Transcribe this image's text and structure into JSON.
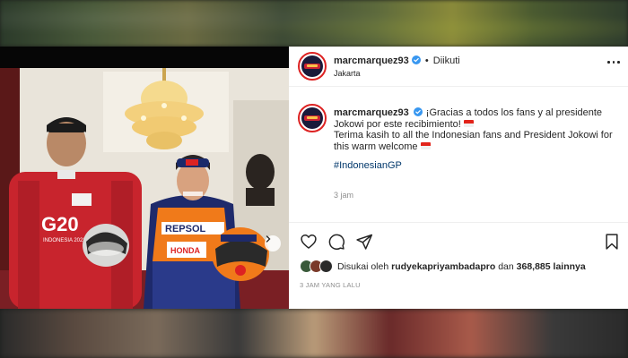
{
  "post": {
    "username": "marcmarquez93",
    "follow_status": "Diikuti",
    "location": "Jakarta",
    "caption": {
      "username": "marcmarquez93",
      "line1": "¡Gracias a todos los fans y al presidente Jokowi por este recibimiento!",
      "line2": "Terima kasih to all the Indonesian fans and President Jokowi for this warm welcome",
      "hashtag": "#IndonesianGP",
      "time": "3 jam"
    },
    "likes": {
      "prefix": "Disukai oleh",
      "user": "rudyekapriyambadapro",
      "connector": "dan",
      "count": "368,885",
      "suffix": "lainnya"
    },
    "timestamp": "3 JAM YANG LALU"
  },
  "photo": {
    "jacket_text": "G20",
    "jacket_subtext": "INDONESIA 2022",
    "suit_brand": "REPSOL",
    "suit_brand2": "HONDA"
  },
  "colors": {
    "link": "#00376b",
    "verified": "#3897f0",
    "text": "#262626",
    "muted": "#8e8e8e",
    "flag_red": "#e2231a"
  },
  "icons": [
    "verified-badge-icon",
    "more-options-icon",
    "next-arrow-icon",
    "heart-icon",
    "comment-icon",
    "share-icon",
    "bookmark-icon",
    "indonesia-flag-icon"
  ]
}
